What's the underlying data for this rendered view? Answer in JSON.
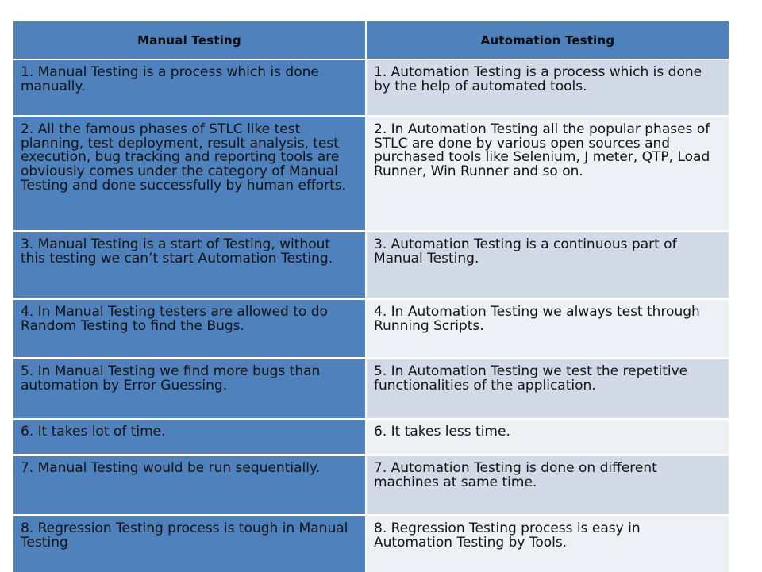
{
  "table": {
    "headers": {
      "left": "Manual  Testing",
      "right": "Automation  Testing"
    },
    "colors": {
      "header_background": "#4F81BD",
      "left_column_background": "#4F81BD",
      "right_row_odd_background": "#D2DAE7",
      "right_row_even_background": "#EDF0F5",
      "text": "#131313",
      "gridline": "#FFFFFF"
    },
    "rows": [
      {
        "left": "1. Manual Testing is a process which is done manually.",
        "right": "1. Automation Testing is a process which is done by the help of automated tools."
      },
      {
        "left": "2. All the famous phases of STLC like test planning, test deployment, result analysis, test execution, bug tracking and reporting tools are obviously comes under the category of Manual Testing and done successfully by human efforts.",
        "right": "2. In Automation Testing all the popular phases of STLC are done by various open sources and purchased tools like Selenium, J meter, QTP, Load Runner, Win Runner and so on."
      },
      {
        "left": "3. Manual Testing is a start of Testing, without this testing we can’t start Automation Testing.",
        "right": "3. Automation Testing is a continuous part of Manual Testing."
      },
      {
        "left": "4. In Manual Testing testers are allowed to do Random Testing to find the Bugs.",
        "right": "4. In Automation Testing we always test through Running Scripts."
      },
      {
        "left": "5. In Manual Testing we find more bugs than automation by Error Guessing.",
        "right": "5. In Automation Testing we test the repetitive functionalities of the application."
      },
      {
        "left": "6. It takes lot of time.",
        "right": "6. It takes less time."
      },
      {
        "left": "7. Manual Testing would be run sequentially.",
        "right": "7. Automation Testing is done on different machines at same time."
      },
      {
        "left": "8. Regression Testing process is tough in Manual Testing",
        "right": "8. Regression Testing process is easy in Automation Testing by Tools."
      }
    ]
  }
}
